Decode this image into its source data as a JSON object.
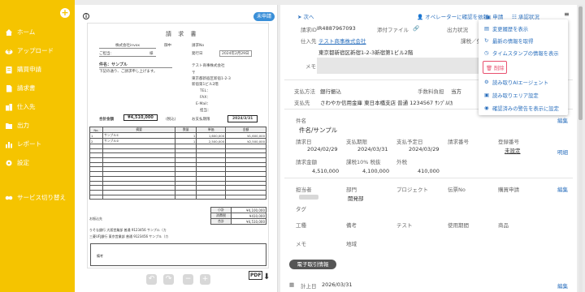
{
  "sidebar": {
    "items": [
      {
        "label": "ホーム",
        "icon": "home-icon"
      },
      {
        "label": "アップロード",
        "icon": "upload-icon"
      },
      {
        "label": "購買申請",
        "icon": "clipboard-icon"
      },
      {
        "label": "請求書",
        "icon": "document-icon"
      },
      {
        "label": "仕入先",
        "icon": "building-icon"
      },
      {
        "label": "出力",
        "icon": "export-icon"
      },
      {
        "label": "レポート",
        "icon": "bar-chart-icon"
      },
      {
        "label": "設定",
        "icon": "gear-icon"
      },
      {
        "label": "サービス切り替え",
        "icon": "switch-icon"
      }
    ]
  },
  "preview": {
    "status_pill": "未申請",
    "doc": {
      "title": "請 求 書",
      "customer": "株式会社invox",
      "onchu": "御中",
      "doc_no_label": "請求No",
      "attn_label": "ご担当：",
      "sama": "様",
      "issue_label": "発行日",
      "issue_date": "2024年2月29日",
      "subject": "件名：サンプル",
      "intro": "下記の通り、ご請求申し上げます。",
      "issuer_name": "テスト商事株式会社",
      "postal": "〒",
      "address1": "東京都新宿区新宿1-2-3",
      "address2": "新宿第1ビル2階",
      "tel": "TEL：",
      "fax": "FAX：",
      "email": "E-Mail：",
      "person": "担当：",
      "total_label": "合計金額",
      "total_value": "¥4,510,000",
      "tax_note": "(税込)",
      "due_label": "お支払期限",
      "due_value": "2024/3/31",
      "table_headers": [
        "No.",
        "摘要",
        "数量",
        "単価",
        "金額"
      ],
      "rows": [
        [
          "1",
          "サンプル①",
          "1",
          "1,600,000",
          "¥1,600,000"
        ],
        [
          "2",
          "サンプル②",
          "1",
          "2,500,000",
          "¥2,500,000"
        ]
      ],
      "summary": [
        {
          "k": "小計",
          "v": "¥4,100,000"
        },
        {
          "k": "消費税",
          "v": "¥410,000"
        },
        {
          "k": "合計",
          "v": "¥4,510,000"
        }
      ],
      "bank_label": "お振込先",
      "bank1": "りそな銀行 大阪営業部 普通 9123456 サンプル（カ",
      "bank2": "三菱UFJ銀行 東京営業部 普通 9123456 サンプル（カ",
      "memo_label": "備考"
    },
    "tools": [
      "↶",
      "↷",
      "−",
      "+"
    ],
    "pdf_label": "PDF",
    "download_icon": "download-icon"
  },
  "panel": {
    "next": "次へ",
    "actions": [
      "オペレーターに確認を依頼",
      "申請",
      "承認状況"
    ],
    "invoice_no_label": "請求ID",
    "invoice_no": "IR4887967093",
    "attachment_label": "添付ファイル",
    "output_label": "出力状況",
    "vendor_label": "仕入先",
    "vendor": "テスト商事株式会社",
    "tax_cls_label": "課税／免",
    "vendor_address": "東京都新宿区新宿1-2-3新宿第1ビル2階",
    "memo_label": "メモ",
    "pay_method_label": "支払方法",
    "pay_method": "銀行振込",
    "fee_label": "手数料負担",
    "fee": "当方",
    "pay_to_label": "支払先",
    "pay_to": "さわやか信用金庫 東日本橋支店 普通 1234567 ｻﾝﾌﾟﾙ(ｶ",
    "subject_label": "件名",
    "subject": "件名/サンプル",
    "edit": "編集",
    "f_invoice_date": "請求日",
    "f_due": "支払期限",
    "f_pay_plan": "支払予定日",
    "f_inv_no": "請求番号",
    "f_reg_no": "登録番号",
    "invoice_date": "2024/02/29",
    "due_date": "2024/03/31",
    "plan_date": "2024/03/29",
    "reg_no": "未設定",
    "detail": "明細",
    "f_amount": "請求金額",
    "f_tax10": "課税10% 税抜",
    "f_exempt": "外税",
    "amount": "4,510,000",
    "tax10": "4,100,000",
    "exempt": "410,000",
    "f_owner": "担当者",
    "f_dept": "部門",
    "f_project": "プロジェクト",
    "f_slip": "伝票No",
    "f_purchase": "購買申請",
    "dept": "開発部",
    "f_tag": "タグ",
    "f_work": "工種",
    "f_remarks": "備考",
    "f_test": "テスト",
    "f_period": "使用期間",
    "f_product": "商品",
    "f_memo": "メモ",
    "f_area": "地域",
    "etax_tag": "電子取引情報",
    "f_recorded": "計上日",
    "recorded": "2026/03/31"
  },
  "dropdown": {
    "items": [
      {
        "label": "変更履歴を表示",
        "icon": "history-icon"
      },
      {
        "label": "最新の情報を取得",
        "icon": "refresh-icon"
      },
      {
        "label": "タイムスタンプの情報を表示",
        "icon": "clock-icon"
      },
      {
        "label": "削除",
        "icon": "trash-icon",
        "danger": true
      },
      {
        "label": "読み取りAIエージェント",
        "icon": "ai-icon"
      },
      {
        "label": "読み取りエリア設定",
        "icon": "area-icon"
      },
      {
        "label": "確認済みの警告を表示に設定",
        "icon": "eye-icon"
      }
    ]
  },
  "colors": {
    "sidebar": "#f5c400",
    "link": "#2a6fbd",
    "danger": "#e8506f",
    "pill": "#3a8fd8"
  }
}
